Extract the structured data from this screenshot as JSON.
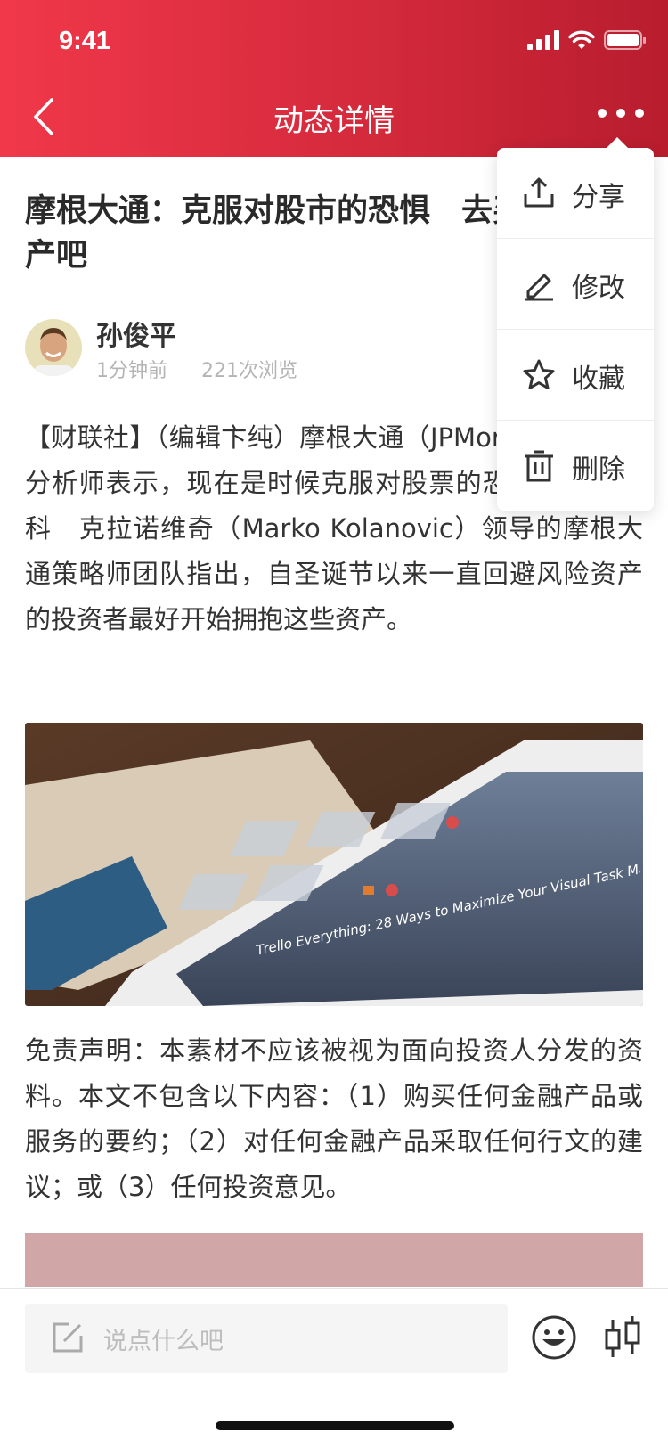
{
  "status_bar": {
    "time": "9:41"
  },
  "nav": {
    "title": "动态详情"
  },
  "article": {
    "title": "摩根大通：克服对股市的恐惧　去买风险资产吧",
    "author": "孙俊平",
    "time_ago": "1分钟前",
    "views": "221次浏览",
    "body": "【财联社】（编辑卞纯）摩根大通（JPMorganChase）分析师表示，现在是时候克服对股票的恐惧了。由马科　克拉诺维奇（Marko Kolanovic）领导的摩根大通策略师团队指出，自圣诞节以来一直回避风险资产的投资者最好开始拥抱这些资产。",
    "photo_caption": "Trello Everything: 28 Ways to Maximize Your Visual Task Management Tool",
    "disclaimer": "免责声明：本素材不应该被视为面向投资人分发的资料。本文不包含以下内容：（1）购买任何金融产品或服务的要约；（2）对任何金融产品采取任何行文的建议；或（3）任何投资意见。"
  },
  "menu": {
    "items": [
      {
        "label": "分享",
        "icon": "share-icon"
      },
      {
        "label": "修改",
        "icon": "edit-icon"
      },
      {
        "label": "收藏",
        "icon": "star-icon"
      },
      {
        "label": "删除",
        "icon": "trash-icon"
      }
    ]
  },
  "bottom": {
    "placeholder": "说点什么吧"
  },
  "colors": {
    "header_start": "#f0384a",
    "header_end": "#b81d2e"
  }
}
